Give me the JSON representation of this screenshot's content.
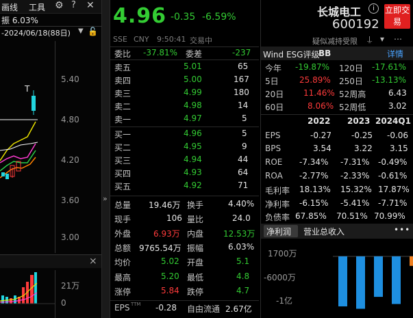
{
  "chart_panel": {
    "toolbar": {
      "draw_label": "画线",
      "tools_label": "工具"
    },
    "amplitude_label": "振 6.03%",
    "change_pct": "6.03%",
    "date_range": "-2024/06/18(88日)",
    "price_axis": [
      "5.40",
      "4.80",
      "4.20",
      "3.60",
      "3.00"
    ],
    "marker": "T",
    "volume_axis": [
      "21万",
      "0"
    ]
  },
  "quote_header": {
    "price": "4.96",
    "change": "-0.35",
    "change_pct": "-6.59%",
    "exchange": "SSE",
    "currency": "CNY",
    "time": "9:50:41",
    "status": "交易中"
  },
  "order_book": {
    "weibi_label": "委比",
    "weibi_value": "-37.81%",
    "weicha_label": "委差",
    "weicha_value": "-237",
    "asks": [
      {
        "label": "卖五",
        "price": "5.01",
        "volume": "65"
      },
      {
        "label": "卖四",
        "price": "5.00",
        "volume": "167"
      },
      {
        "label": "卖三",
        "price": "4.99",
        "volume": "180"
      },
      {
        "label": "卖二",
        "price": "4.98",
        "volume": "14"
      },
      {
        "label": "卖一",
        "price": "4.97",
        "volume": "5"
      }
    ],
    "bids": [
      {
        "label": "买一",
        "price": "4.96",
        "volume": "5"
      },
      {
        "label": "买二",
        "price": "4.95",
        "volume": "9"
      },
      {
        "label": "买三",
        "price": "4.94",
        "volume": "44"
      },
      {
        "label": "买四",
        "price": "4.93",
        "volume": "64"
      },
      {
        "label": "买五",
        "price": "4.92",
        "volume": "71"
      }
    ]
  },
  "stats": [
    {
      "l1": "总量",
      "v1": "19.46万",
      "l2": "换手",
      "v2": "4.40%",
      "c1": "white",
      "c2": "white"
    },
    {
      "l1": "现手",
      "v1": "106",
      "l2": "量比",
      "v2": "24.0",
      "c1": "white",
      "c2": "white"
    },
    {
      "l1": "外盘",
      "v1": "6.93万",
      "l2": "内盘",
      "v2": "12.53万",
      "c1": "red",
      "c2": "green"
    },
    {
      "l1": "总额",
      "v1": "9765.54万",
      "l2": "振幅",
      "v2": "6.03%",
      "c1": "white",
      "c2": "white"
    },
    {
      "l1": "均价",
      "v1": "5.02",
      "l2": "开盘",
      "v2": "5.1",
      "c1": "green",
      "c2": "green"
    },
    {
      "l1": "最高",
      "v1": "5.20",
      "l2": "最低",
      "v2": "4.8",
      "c1": "green",
      "c2": "green"
    },
    {
      "l1": "涨停",
      "v1": "5.84",
      "l2": "跌停",
      "v2": "4.7",
      "c1": "red",
      "c2": "green"
    },
    {
      "l1": "EPS",
      "v1": "-0.28",
      "l2": "自由流通",
      "v2": "2.67亿",
      "c1": "white",
      "c2": "white"
    }
  ],
  "eps_sup": "TTM",
  "stock": {
    "name": "长城电工",
    "code": "600192",
    "info_icon_label": "i",
    "trade_button": "立即交易",
    "suspected_tag": "疑似减持受限"
  },
  "esg": {
    "label": "Wind ESG评级",
    "rating": "BB",
    "detail_link": "详情"
  },
  "periods": [
    {
      "l1": "今年",
      "v1": "-19.87%",
      "c1": "green",
      "l2": "120日",
      "v2": "-17.61%",
      "c2": "green"
    },
    {
      "l1": "5日",
      "v1": "25.89%",
      "c1": "red",
      "l2": "250日",
      "v2": "-13.13%",
      "c2": "green"
    },
    {
      "l1": "20日",
      "v1": "11.46%",
      "c1": "red",
      "l2": "52周高",
      "v2": "6.43",
      "c2": "white"
    },
    {
      "l1": "60日",
      "v1": "8.06%",
      "c1": "red",
      "l2": "52周低",
      "v2": "3.02",
      "c2": "white"
    }
  ],
  "financials": {
    "columns": [
      "2022",
      "2023",
      "2024Q1"
    ],
    "rows": [
      {
        "label": "EPS",
        "values": [
          "-0.27",
          "-0.25",
          "-0.06"
        ]
      },
      {
        "label": "BPS",
        "values": [
          "3.54",
          "3.22",
          "3.15"
        ]
      },
      {
        "label": "ROE",
        "values": [
          "-7.34%",
          "-7.31%",
          "-0.49%"
        ]
      },
      {
        "label": "ROA",
        "values": [
          "-2.77%",
          "-2.33%",
          "-0.61%"
        ]
      },
      {
        "label": "毛利率",
        "values": [
          "18.13%",
          "15.32%",
          "17.87%"
        ]
      },
      {
        "label": "净利率",
        "values": [
          "-6.15%",
          "-5.41%",
          "-7.71%"
        ]
      },
      {
        "label": "负债率",
        "values": [
          "67.85%",
          "70.51%",
          "70.99%"
        ]
      }
    ]
  },
  "profit_tabs": {
    "net_profit": "净利润",
    "revenue": "营业总收入",
    "more": "•••"
  },
  "chart_data": {
    "type": "bar",
    "y_ticks": [
      "1700万",
      "-6000万",
      "-1亿"
    ],
    "series": [
      {
        "values": [
          -1.05,
          -1.1,
          -0.85,
          -1.0,
          -0.2
        ]
      }
    ],
    "ylim": [
      -1.15,
      0.17
    ],
    "colors": [
      "#1e8fe0",
      "#1e8fe0",
      "#1e8fe0",
      "#1e8fe0",
      "#f08020"
    ]
  }
}
